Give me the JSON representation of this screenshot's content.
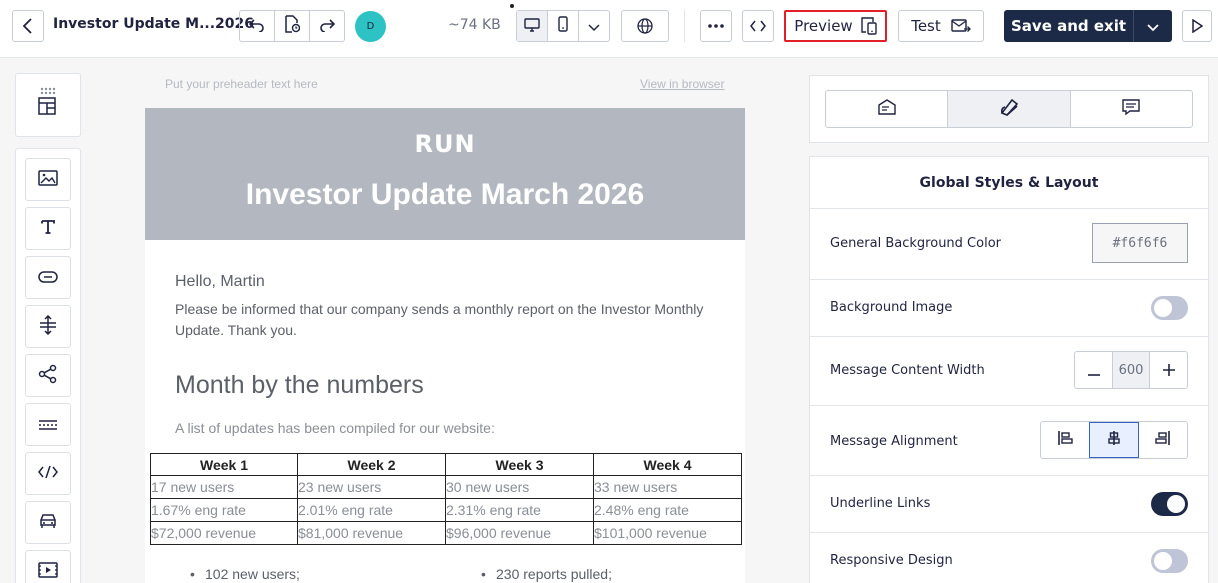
{
  "header": {
    "doc_title": "Investor Update M...2026",
    "size": "~74 KB",
    "avatar_initial": "D",
    "preview_label": "Preview",
    "test_label": "Test",
    "save_label": "Save and exit"
  },
  "email": {
    "preheader": "Put your preheader text here",
    "view_in_browser": "View in browser",
    "logo_text": "RUN",
    "hero_title": "Investor Update March 2026",
    "greeting": "Hello, Martin",
    "intro": "Please be informed that our company sends a monthly report on the Investor Monthly Update. Thank you.",
    "section_heading": "Month by the numbers",
    "section_sub": "A list of updates has been compiled for our website:",
    "table": {
      "headers": [
        "Week 1",
        "Week 2",
        "Week 3",
        "Week 4"
      ],
      "rows": [
        [
          "17 new users",
          "23 new users",
          "30 new users",
          "33 new users"
        ],
        [
          "1.67% eng rate",
          "2.01% eng rate",
          "2.31% eng rate",
          "2.48% eng rate"
        ],
        [
          "$72,000 revenue",
          "$81,000 revenue",
          "$96,000 revenue",
          "$101,000 revenue"
        ]
      ]
    },
    "bullets": [
      "102 new users;",
      "230 reports pulled;"
    ]
  },
  "panel": {
    "title": "Global Styles & Layout",
    "general_bg_label": "General Background Color",
    "general_bg_value": "#f6f6f6",
    "bg_image_label": "Background Image",
    "bg_image_on": false,
    "content_width_label": "Message Content Width",
    "content_width_value": "600",
    "alignment_label": "Message Alignment",
    "alignment_value": "center",
    "underline_label": "Underline Links",
    "underline_on": true,
    "responsive_label": "Responsive Design",
    "responsive_on": false
  },
  "colors": {
    "brand_dark": "#1c2a48",
    "highlight_red": "#e41e26",
    "hero_bg": "#b3b8c0",
    "avatar": "#2dc3c4"
  },
  "icons": {
    "palette": [
      "image-icon",
      "text-icon",
      "button-icon",
      "spacer-icon",
      "social-icon",
      "divider-icon",
      "html-icon",
      "menu-icon",
      "video-icon"
    ]
  }
}
